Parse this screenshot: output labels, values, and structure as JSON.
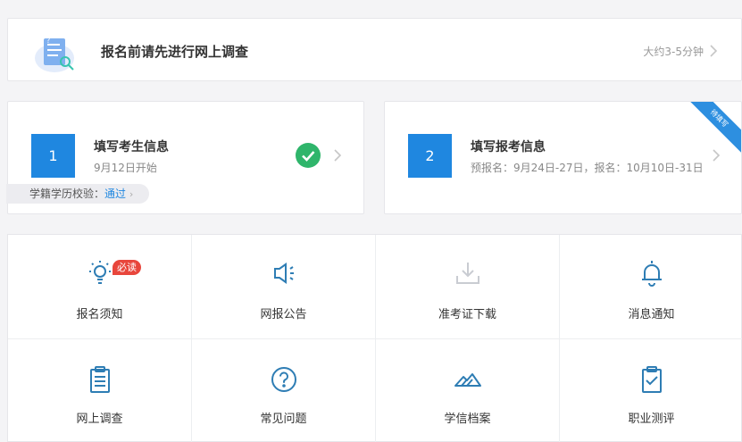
{
  "colors": {
    "accent": "#1f87e0",
    "check": "#2fb56b",
    "icon": "#2e7db4",
    "badge": "#e8463c",
    "disabled": "#c9ccd2"
  },
  "survey": {
    "title": "报名前请先进行网上调查",
    "time": "大约3-5分钟"
  },
  "steps": [
    {
      "num": "1",
      "title": "填写考生信息",
      "subtitle": "9月12日开始",
      "status": "done",
      "verify_label": "学籍学历校验：",
      "verify_link": "通过"
    },
    {
      "num": "2",
      "title": "填写报考信息",
      "subtitle": "预报名：9月24日-27日，报名：10月10日-31日",
      "ribbon": "待填写"
    }
  ],
  "menu": [
    {
      "label": "报名须知",
      "icon": "bulb-icon",
      "badge": "必读"
    },
    {
      "label": "网报公告",
      "icon": "speaker-icon"
    },
    {
      "label": "准考证下载",
      "icon": "download-icon",
      "disabled": true
    },
    {
      "label": "消息通知",
      "icon": "bell-icon"
    },
    {
      "label": "网上调查",
      "icon": "clipboard-icon"
    },
    {
      "label": "常见问题",
      "icon": "question-icon"
    },
    {
      "label": "学信档案",
      "icon": "archive-icon"
    },
    {
      "label": "职业测评",
      "icon": "clipboard-check-icon"
    }
  ]
}
